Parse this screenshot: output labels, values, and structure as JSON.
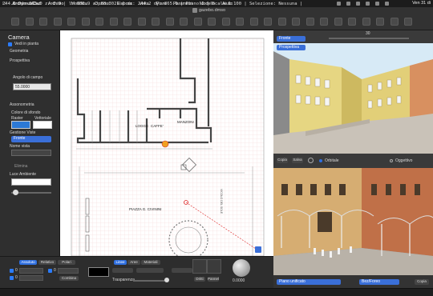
{
  "menu": {
    "app": "ArchimusCad",
    "items": [
      "Archivio",
      "Modifica",
      "Opzioni",
      "Elabora",
      "Vista",
      "Piani",
      "Parametri",
      "Modello",
      "Aiuto"
    ],
    "clock": "Ven 31 di"
  },
  "window": {
    "title": "gazebo.dmso"
  },
  "toolbar": {
    "icons": [
      "new-icon",
      "open-icon",
      "save-icon",
      "print-icon",
      "undo-icon",
      "redo-icon",
      "cut-icon",
      "copy-icon",
      "paste-icon",
      "wall-icon",
      "door-icon",
      "window-icon",
      "stair-icon",
      "roof-icon",
      "dimension-icon",
      "text-icon",
      "zoom-in-icon",
      "zoom-out-icon",
      "pan-icon",
      "select-icon",
      "rotate-icon",
      "measure-icon",
      "layer-icon",
      "3d-icon",
      "render-icon",
      "camera-icon",
      "light-icon",
      "settings-icon",
      "help-icon"
    ]
  },
  "left_panel": {
    "title": "Camera",
    "visible_in_plan": "Vedi in pianta",
    "geometry": "Geometria",
    "perspective": "Prospettiva",
    "angle_label": "Angolo di campo",
    "angle_value": "55.0000",
    "assonometry": "Assonometria",
    "bg_color": "Colore di sfondo",
    "raster": "Raster",
    "vector": "Vettoriale",
    "view_mgmt": "Gestione Viste",
    "view_select": "Fronte",
    "view_name": "Nome vista",
    "delete": "Elimina",
    "ambient_light": "Luce Ambiente"
  },
  "plan": {
    "labels": [
      "LOGGE",
      "CAFFE'",
      "MANZONI",
      "PIAZZA G. CIVININI",
      "VICOLO DEL SOLE"
    ]
  },
  "view3d": {
    "view_select": "Fronte",
    "projection_select": "Prospettiva",
    "zoom_label": "30",
    "copy": "Copia",
    "save": "Salva",
    "orbit": "Orbitale",
    "object": "Oggettivo"
  },
  "render": {
    "mode_select": "Piano unificato",
    "style_select": "Bez/Foreo",
    "copy": "Copia"
  },
  "bottom": {
    "tabs": [
      "Assoluto",
      "Relativo",
      "Polari"
    ],
    "combine": "Combina",
    "line_tabs": [
      "Linee",
      "Aree",
      "Materiali"
    ],
    "transparency": "Trasparenza",
    "draw": "Dritti",
    "panel": "Pannel",
    "value": "0.0000",
    "coord_x": "0",
    "coord_y": "0",
    "coord_z": "0"
  },
  "status": "244.2 Dy:     865.0 z:     0.0 | l:     930.9 a:  68.3021 | dx:     244.2 dy:     865.0 | Piano 2 | Scala 1:100 | Selezione: Nessuna |",
  "colors": {
    "accent": "#2f6fe0",
    "grid": "#f0c8c8",
    "wall": "#333333",
    "building_yellow": "#e8d37a"
  }
}
